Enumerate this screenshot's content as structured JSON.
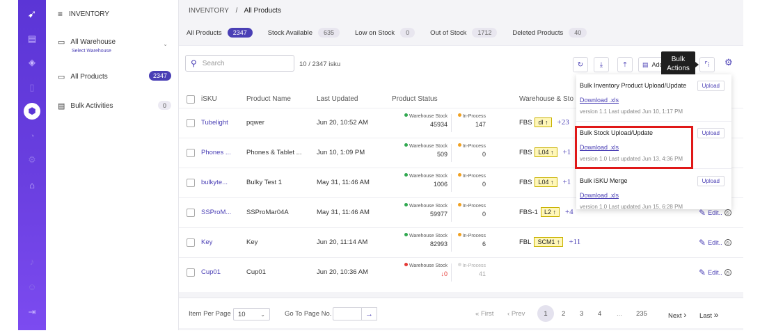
{
  "sidebar": {
    "module_title": "INVENTORY",
    "warehouse_label": "All Warehouse",
    "warehouse_sub": "Select Warehouse",
    "items": [
      {
        "label": "All Products",
        "count": "2347"
      },
      {
        "label": "Bulk Activities",
        "count": "0"
      }
    ]
  },
  "breadcrumb": {
    "root": "INVENTORY",
    "separator": "/",
    "current": "All Products"
  },
  "tabs": [
    {
      "label": "All Products",
      "count": "2347"
    },
    {
      "label": "Stock Available",
      "count": "635"
    },
    {
      "label": "Low on Stock",
      "count": "0"
    },
    {
      "label": "Out of Stock",
      "count": "1712"
    },
    {
      "label": "Deleted Products",
      "count": "40"
    }
  ],
  "toolbar": {
    "search_placeholder": "Search",
    "count_text": "10 / 2347 isku",
    "add_label": "Add",
    "tooltip_line1": "Bulk",
    "tooltip_line2": "Actions"
  },
  "table": {
    "headers": [
      "iSKU",
      "Product Name",
      "Last Updated",
      "Product Status",
      "Warehouse & Sto"
    ],
    "ws_label": "Warehouse Stock",
    "ip_label": "In-Process",
    "edit_label": "Edit..",
    "rows": [
      {
        "isku": "Tubelight",
        "name": "pqwer",
        "updated": "Jun 20, 10:52 AM",
        "ws": "45934",
        "ip": "147",
        "wh": "FBS",
        "tag": "dl ↑",
        "more": "+23"
      },
      {
        "isku": "Phones ...",
        "name": "Phones & Tablet ...",
        "updated": "Jun 10, 1:09 PM",
        "ws": "509",
        "ip": "0",
        "wh": "FBS",
        "tag": "L04 ↑",
        "more": "+1"
      },
      {
        "isku": "bulkyte...",
        "name": "Bulky Test 1",
        "updated": "May 31, 11:46 AM",
        "ws": "1006",
        "ip": "0",
        "wh": "FBS",
        "tag": "L04 ↑",
        "more": "+1"
      },
      {
        "isku": "SSProM...",
        "name": "SSProMar04A",
        "updated": "May 31, 11:46 AM",
        "ws": "59977",
        "ip": "0",
        "wh": "FBS-1",
        "tag": "L2 ↑",
        "more": "+4"
      },
      {
        "isku": "Key",
        "name": "Key",
        "updated": "Jun 20, 11:14 AM",
        "ws": "82993",
        "ip": "6",
        "wh": "FBL",
        "tag": "SCM1 ↑",
        "more": "+11"
      },
      {
        "isku": "Cup01",
        "name": "Cup01",
        "updated": "Jun 20, 10:36 AM",
        "ws": "↓0",
        "ip": "41",
        "wh": "",
        "tag": "",
        "more": ""
      }
    ]
  },
  "pagination": {
    "per_page_label": "Item Per Page",
    "per_page_value": "10",
    "goto_label": "Go To Page No.",
    "first": "First",
    "prev": "Prev",
    "pages": [
      "1",
      "2",
      "3",
      "4",
      "...",
      "235"
    ],
    "next": "Next",
    "last": "Last"
  },
  "bulk_menu": [
    {
      "title": "Bulk Inventory Product Upload/Update",
      "link": "Download .xls",
      "meta": "version 1.1 Last updated Jun 10, 1:17 PM",
      "button": "Upload"
    },
    {
      "title": "Bulk Stock Upload/Update",
      "link": "Download .xls",
      "meta": "version 1.0 Last updated Jun 13, 4:36 PM",
      "button": "Upload"
    },
    {
      "title": "Bulk iSKU Merge",
      "link": "Download .xls",
      "meta": "version 1.0 Last updated Jun 15, 6:28 PM",
      "button": "Upload"
    }
  ],
  "colors": {
    "accent": "#4a3fb5",
    "rail": "#6a3fe0",
    "highlight": "#e01818",
    "green": "#2fa84f",
    "orange": "#f0a020",
    "red": "#e53935"
  }
}
